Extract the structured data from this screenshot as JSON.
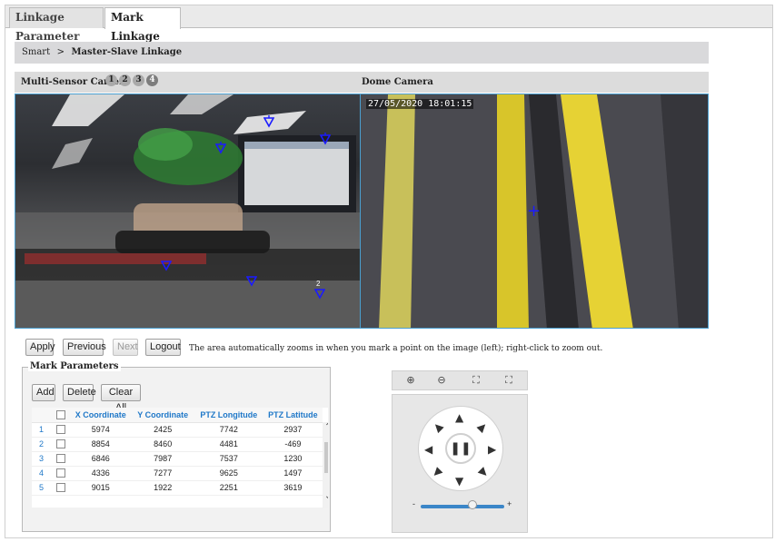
{
  "tabs": [
    {
      "label": "Linkage Parameter",
      "active": false
    },
    {
      "label": "Mark Linkage",
      "active": true
    }
  ],
  "breadcrumb": {
    "root": "Smart",
    "separator": ">",
    "current": "Master-Slave Linkage"
  },
  "left_camera": {
    "label": "Multi-Sensor Camera",
    "sensors": [
      "1",
      "2",
      "3",
      "4"
    ],
    "selected_sensor": "4"
  },
  "right_camera": {
    "label": "Dome Camera",
    "timestamp": "27/05/2020 18:01:15"
  },
  "markers": [
    {
      "id": "5",
      "label": ""
    },
    {
      "id": "3",
      "label": ""
    },
    {
      "id": "4",
      "label": ""
    },
    {
      "id": "1",
      "label": ""
    },
    {
      "id": "6",
      "label": ""
    },
    {
      "id": "2",
      "label": "2"
    }
  ],
  "actions": {
    "apply": "Apply",
    "previous": "Previous",
    "next": "Next",
    "logout": "Logout"
  },
  "hint_text": "The area automatically zooms in when you mark a point on the image (left); right-click to zoom out.",
  "mark_parameters": {
    "legend": "Mark Parameters",
    "buttons": {
      "add": "Add",
      "delete": "Delete",
      "clear_all": "Clear All"
    },
    "columns": [
      "X Coordinate",
      "Y Coordinate",
      "PTZ Longitude",
      "PTZ Latitude"
    ],
    "rows": [
      {
        "index": "1",
        "x": "5974",
        "y": "2425",
        "lon": "7742",
        "lat": "2937"
      },
      {
        "index": "2",
        "x": "8854",
        "y": "8460",
        "lon": "4481",
        "lat": "-469"
      },
      {
        "index": "3",
        "x": "6846",
        "y": "7987",
        "lon": "7537",
        "lat": "1230"
      },
      {
        "index": "4",
        "x": "4336",
        "y": "7277",
        "lon": "9625",
        "lat": "1497"
      },
      {
        "index": "5",
        "x": "9015",
        "y": "1922",
        "lon": "2251",
        "lat": "3619"
      }
    ]
  },
  "ptz": {
    "tools": [
      "zoom-in-icon",
      "zoom-out-icon",
      "area-zoom-in-icon",
      "area-zoom-out-icon"
    ],
    "center_symbol": "❚❚",
    "slider_min": "-",
    "slider_max": "+",
    "speed_level": 0.62
  },
  "colors": {
    "accent": "#1f78c8",
    "video_border": "#4a9fd0",
    "crosshair": "#1b1bff"
  }
}
